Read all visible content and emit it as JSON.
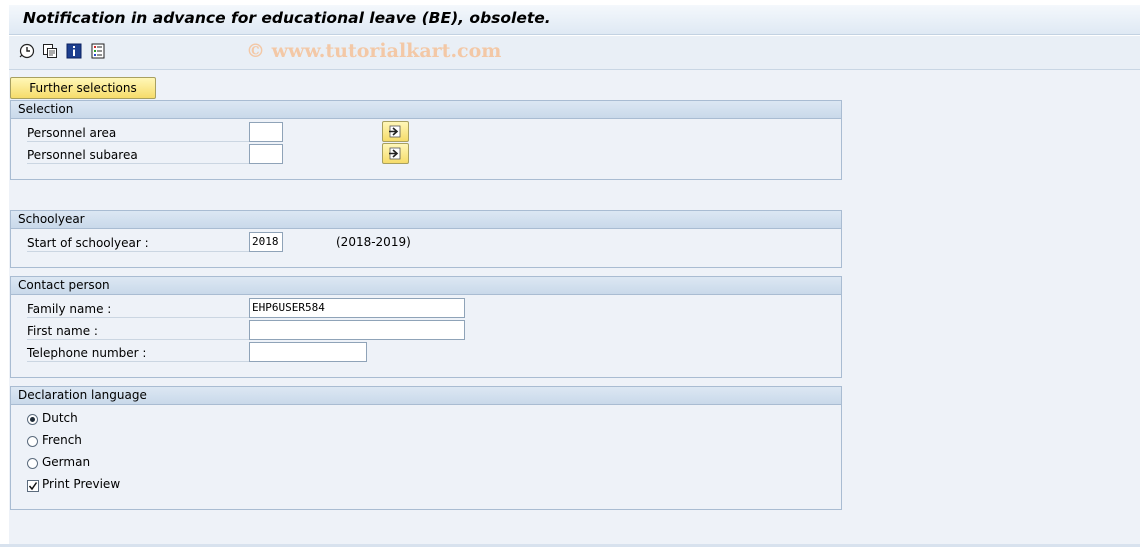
{
  "title": "Notification in advance for educational leave (BE), obsolete.",
  "toolbar": {
    "icons": [
      "execute-icon",
      "copy-variant-icon",
      "info-icon",
      "selection-options-icon"
    ]
  },
  "watermark": "© www.tutorialkart.com",
  "further_selections_label": "Further selections",
  "selection": {
    "header": "Selection",
    "personnel_area_label": "Personnel area",
    "personnel_area_value": "",
    "personnel_subarea_label": "Personnel subarea",
    "personnel_subarea_value": ""
  },
  "schoolyear": {
    "header": "Schoolyear",
    "start_label": "Start of schoolyear :",
    "start_value": "2018",
    "range_text": "(2018-2019)"
  },
  "contact": {
    "header": "Contact person",
    "family_label": "Family name :",
    "family_value": "EHP6USER584",
    "first_label": "First name :",
    "first_value": "",
    "phone_label": "Telephone number :",
    "phone_value": ""
  },
  "language": {
    "header": "Declaration language",
    "options": [
      {
        "label": "Dutch",
        "selected": true
      },
      {
        "label": "French",
        "selected": false
      },
      {
        "label": "German",
        "selected": false
      }
    ],
    "print_preview_label": "Print Preview",
    "print_preview_checked": true
  },
  "colors": {
    "button_yellow": "#f6dc6a",
    "group_border": "#a9bcd2",
    "background": "#eef2f8"
  }
}
